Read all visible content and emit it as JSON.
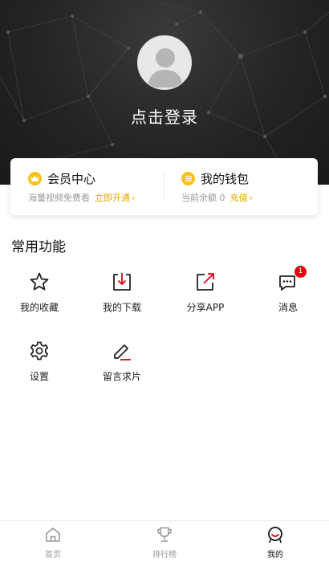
{
  "header": {
    "login_text": "点击登录"
  },
  "card": {
    "vip": {
      "title": "会员中心",
      "subtitle": "海量视频免费看",
      "link": "立即开通"
    },
    "wallet": {
      "title": "我的钱包",
      "subtitle": "当前余额 0",
      "link": "充值"
    }
  },
  "section": {
    "title": "常用功能"
  },
  "functions": [
    {
      "label": "我的收藏",
      "icon": "star-icon"
    },
    {
      "label": "我的下载",
      "icon": "download-icon"
    },
    {
      "label": "分享APP",
      "icon": "share-icon"
    },
    {
      "label": "消息",
      "icon": "message-icon",
      "badge": "1"
    },
    {
      "label": "设置",
      "icon": "gear-icon"
    },
    {
      "label": "留言求片",
      "icon": "edit-icon"
    }
  ],
  "tabbar": [
    {
      "label": "首页",
      "icon": "home-icon",
      "active": false
    },
    {
      "label": "排行榜",
      "icon": "trophy-icon",
      "active": false
    },
    {
      "label": "我的",
      "icon": "profile-icon",
      "active": true
    }
  ],
  "colors": {
    "accent": "#e6a800",
    "vip_gold": "#f6c21a",
    "badge_red": "#e60012",
    "header_dark": "#242424"
  }
}
